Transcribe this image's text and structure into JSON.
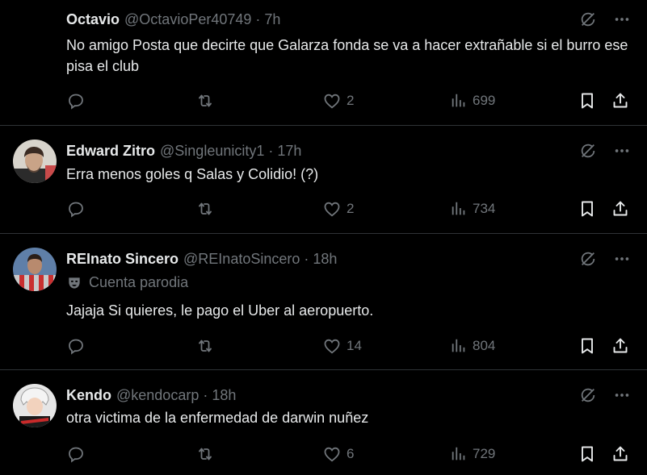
{
  "tweets": [
    {
      "name": "Octavio",
      "handle": "@OctavioPer40749",
      "time": "7h",
      "parody_label": "",
      "text": "No amigo Posta que decirte que Galarza fonda se va a hacer extrañable si el burro ese pisa el club",
      "likes": "2",
      "views": "699",
      "avatar": "none"
    },
    {
      "name": "Edward Zitro",
      "handle": "@Singleunicity1",
      "time": "17h",
      "parody_label": "",
      "text": "Erra menos goles q Salas y Colidio! (?)",
      "likes": "2",
      "views": "734",
      "avatar": "man-photo"
    },
    {
      "name": "REInato Sincero",
      "handle": "@REInatoSincero",
      "time": "18h",
      "parody_label": "Cuenta parodia",
      "text": "Jajaja Si quieres, le pago el Uber al aeropuerto.",
      "likes": "14",
      "views": "804",
      "avatar": "player-photo"
    },
    {
      "name": "Kendo",
      "handle": "@kendocarp",
      "time": "18h",
      "parody_label": "",
      "text": "otra victima de la enfermedad de darwin nuñez",
      "likes": "6",
      "views": "729",
      "avatar": "anime-character"
    }
  ],
  "icons": {
    "reply": "reply-icon",
    "retweet": "retweet-icon",
    "like": "heart-icon",
    "views": "views-icon",
    "bookmark": "bookmark-icon",
    "share": "share-icon",
    "grok": "grok-icon",
    "more": "more-icon",
    "parody": "theater-mask-icon"
  },
  "colors": {
    "background": "#000000",
    "text": "#e7e9ea",
    "muted": "#71767b",
    "divider": "#2f3336"
  }
}
